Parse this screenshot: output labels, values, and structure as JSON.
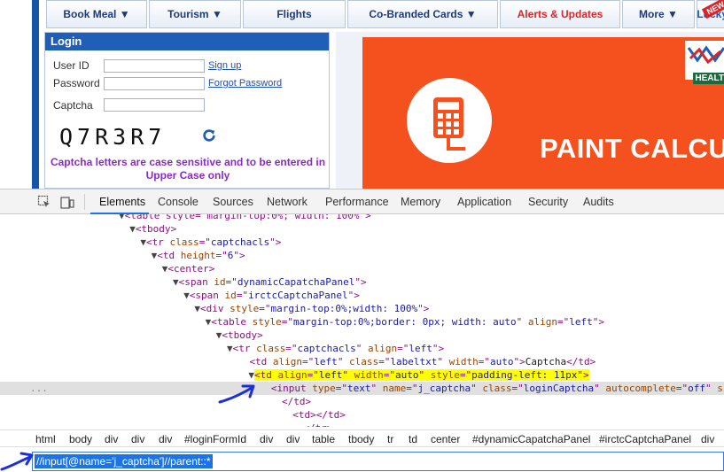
{
  "nav": {
    "book_meal": "Book Meal ▼",
    "tourism": "Tourism ▼",
    "flights": "Flights",
    "cobranded": "Co-Branded Cards ▼",
    "alerts": "Alerts & Updates",
    "more": "More ▼",
    "new_badge": "NEW",
    "lucky": "Lucky"
  },
  "login": {
    "title": "Login",
    "userid_label": "User ID",
    "password_label": "Password",
    "captcha_label": "Captcha",
    "signup": "Sign up",
    "forgot": "Forgot Password",
    "captcha_text": "Q7R3R7",
    "note": "Captcha letters are case sensitive and to be entered in Upper Case only"
  },
  "banner": {
    "title": "PAINT CALCU",
    "logo_text": "HEALT"
  },
  "devtools": {
    "tabs": [
      "Elements",
      "Console",
      "Sources",
      "Network",
      "Performance",
      "Memory",
      "Application",
      "Security",
      "Audits"
    ],
    "active_tab": "Elements",
    "ellipsis": "...",
    "dom": [
      {
        "triangle": "▼",
        "raw": "<table style=\"margin-top:0%; width: 100%\">"
      },
      {
        "triangle": "▼",
        "tag": "tbody",
        "attrs": []
      },
      {
        "triangle": "▼",
        "tag": "tr",
        "attrs": [
          {
            "n": "class",
            "v": "captchacls"
          }
        ]
      },
      {
        "triangle": "▼",
        "tag": "td",
        "attrs": [
          {
            "n": "height",
            "v": "6"
          }
        ]
      },
      {
        "triangle": "▼",
        "tag": "center",
        "attrs": []
      },
      {
        "triangle": "▼",
        "tag": "span",
        "attrs": [
          {
            "n": "id",
            "v": "dynamicCapatchaPanel"
          }
        ]
      },
      {
        "triangle": "▼",
        "tag": "span",
        "attrs": [
          {
            "n": "id",
            "v": "irctcCaptchaPanel"
          }
        ]
      },
      {
        "triangle": "▼",
        "tag": "div",
        "attrs": [
          {
            "n": "style",
            "v": "margin-top:0%;width: 100%"
          }
        ]
      },
      {
        "triangle": "▼",
        "tag": "table",
        "attrs": [
          {
            "n": "style",
            "v": "margin-top:0%;border: 0px; width: auto"
          },
          {
            "n": "align",
            "v": "left"
          }
        ]
      },
      {
        "triangle": "▼",
        "tag": "tbody",
        "attrs": []
      },
      {
        "triangle": "▼",
        "tag": "tr",
        "attrs": [
          {
            "n": "class",
            "v": "captchacls"
          },
          {
            "n": "align",
            "v": "left"
          }
        ]
      },
      {
        "triangle": "",
        "tag": "td",
        "attrs": [
          {
            "n": "align",
            "v": "left"
          },
          {
            "n": "class",
            "v": "labeltxt"
          },
          {
            "n": "width",
            "v": "auto"
          }
        ],
        "text": "Captcha",
        "close": "td"
      },
      {
        "triangle": "▼",
        "tag": "td",
        "attrs": [
          {
            "n": "align",
            "v": "left"
          },
          {
            "n": "width",
            "v": "auto"
          },
          {
            "n": "style",
            "v": "padding-left: 11px"
          }
        ],
        "highlight": true
      },
      {
        "triangle": "",
        "tag": "input",
        "attrs": [
          {
            "n": "type",
            "v": "text"
          },
          {
            "n": "name",
            "v": "j_captcha"
          },
          {
            "n": "class",
            "v": "loginCaptcha"
          },
          {
            "n": "autocomplete",
            "v": "off"
          }
        ],
        "suffix": " size=",
        "selected": true
      },
      {
        "triangle": "",
        "raw": "</td>"
      },
      {
        "triangle": "",
        "raw": "<td></td>"
      },
      {
        "triangle": "",
        "raw": "</tr>"
      }
    ],
    "breadcrumbs": [
      "html",
      "body",
      "div",
      "div",
      "div",
      "#loginFormId",
      "div",
      "div",
      "table",
      "tbody",
      "tr",
      "td",
      "center",
      "#dynamicCapatchaPanel",
      "#irctcCaptchaPanel",
      "div"
    ],
    "search_value": "//input[@name='j_captcha']//parent::*"
  },
  "colors": {
    "brand_blue": "#1f5fb8",
    "banner_orange": "#f5511e",
    "highlight_yellow": "#ffff00",
    "selection_blue": "#1a73e8",
    "annotation_blue": "#1c2fd8"
  }
}
